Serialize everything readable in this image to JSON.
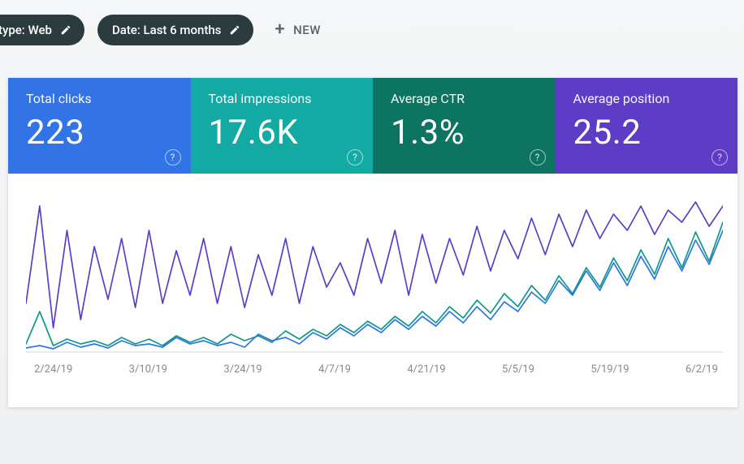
{
  "filters": {
    "search_type": {
      "label": "type: Web"
    },
    "date_range": {
      "label": "Date: Last 6 months"
    },
    "new_button": {
      "label": "NEW"
    }
  },
  "metrics": {
    "total_clicks": {
      "label": "Total clicks",
      "value": "223"
    },
    "total_impressions": {
      "label": "Total impressions",
      "value": "17.6K"
    },
    "average_ctr": {
      "label": "Average CTR",
      "value": "1.3%"
    },
    "average_position": {
      "label": "Average position",
      "value": "25.2"
    }
  },
  "chart_data": {
    "type": "line",
    "x_ticks": [
      "2/24/19",
      "3/10/19",
      "3/24/19",
      "4/7/19",
      "4/21/19",
      "5/5/19",
      "5/19/19",
      "6/2/19"
    ],
    "series": [
      {
        "name": "Total impressions",
        "color": "#5d3cc6",
        "values": [
          60,
          180,
          30,
          150,
          40,
          130,
          65,
          140,
          55,
          150,
          60,
          125,
          70,
          140,
          60,
          130,
          55,
          120,
          70,
          140,
          60,
          130,
          80,
          110,
          70,
          140,
          85,
          150,
          70,
          145,
          85,
          140,
          95,
          155,
          100,
          150,
          115,
          165,
          120,
          170,
          130,
          175,
          140,
          170,
          150,
          180,
          145,
          175,
          160,
          185,
          155,
          180
        ]
      },
      {
        "name": "Total clicks",
        "color": "#3273e6",
        "values": [
          5,
          8,
          4,
          12,
          6,
          10,
          5,
          14,
          8,
          10,
          6,
          18,
          10,
          14,
          8,
          12,
          6,
          22,
          14,
          18,
          10,
          24,
          16,
          30,
          20,
          34,
          24,
          40,
          28,
          44,
          32,
          50,
          36,
          56,
          40,
          62,
          50,
          74,
          60,
          88,
          70,
          100,
          76,
          110,
          82,
          118,
          90,
          130,
          100,
          138,
          108,
          150
        ]
      },
      {
        "name": "Average CTR",
        "color": "#0d9a85",
        "values": [
          10,
          50,
          8,
          16,
          10,
          14,
          8,
          18,
          10,
          16,
          8,
          20,
          12,
          18,
          10,
          22,
          14,
          20,
          12,
          26,
          16,
          28,
          20,
          34,
          24,
          38,
          28,
          44,
          32,
          50,
          36,
          56,
          42,
          64,
          48,
          72,
          56,
          82,
          64,
          94,
          72,
          104,
          80,
          116,
          88,
          126,
          96,
          140,
          104,
          148,
          112,
          160
        ]
      }
    ],
    "ylim": [
      0,
      200
    ]
  }
}
